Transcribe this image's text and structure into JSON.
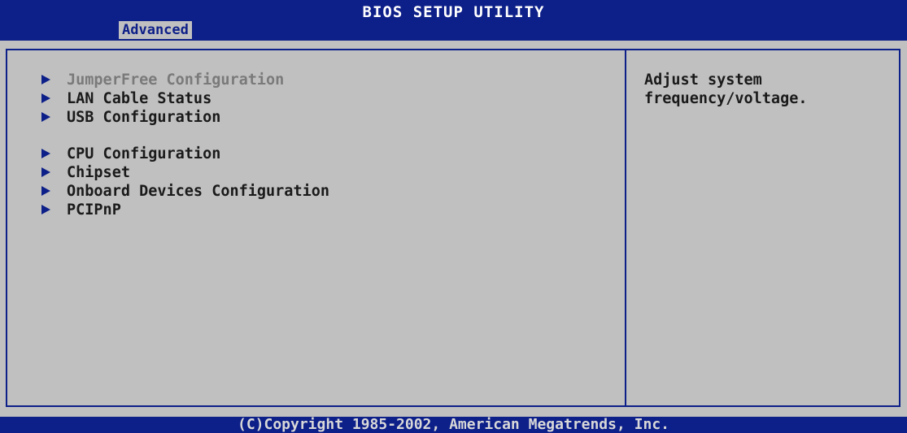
{
  "window": {
    "title": "BIOS SETUP UTILITY",
    "active_tab": "Advanced"
  },
  "menu": {
    "items": [
      {
        "label": "JumperFree Configuration",
        "icon": "right-arrow-icon",
        "highlighted": true
      },
      {
        "label": "LAN Cable Status",
        "icon": "right-arrow-icon"
      },
      {
        "label": "USB Configuration",
        "icon": "right-arrow-icon"
      },
      {
        "label": "CPU Configuration",
        "icon": "right-arrow-icon"
      },
      {
        "label": "Chipset",
        "icon": "right-arrow-icon"
      },
      {
        "label": "Onboard Devices Configuration",
        "icon": "right-arrow-icon"
      },
      {
        "label": "PCIPnP",
        "icon": "right-arrow-icon"
      }
    ]
  },
  "help": {
    "lines": [
      "Adjust system",
      "frequency/voltage."
    ]
  },
  "footer": {
    "copyright": "(C)Copyright 1985-2002, American Megatrends, Inc."
  },
  "colors": {
    "bar": "#0d1f88",
    "background": "#c0c0c0",
    "text": "#1a1a1a",
    "highlight_text": "#7a7a7a"
  }
}
